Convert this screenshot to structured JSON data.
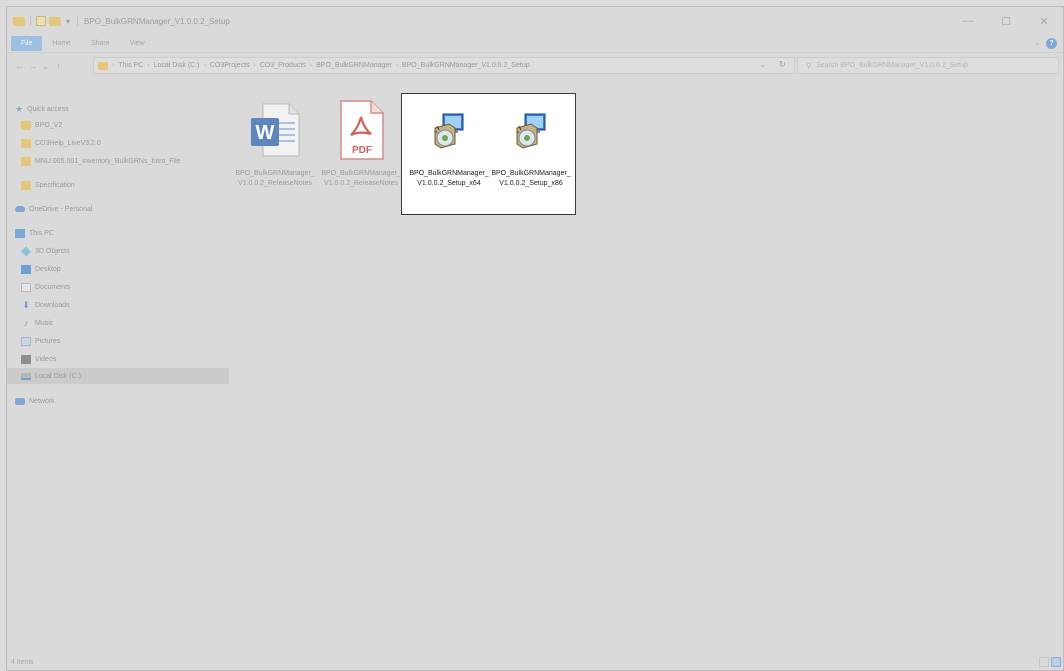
{
  "window": {
    "title": "BPO_BulkGRNManager_V1.0.0.2_Setup",
    "controls": {
      "minimize": "—",
      "maximize": "☐",
      "close": "✕"
    }
  },
  "ribbon": {
    "tabs": [
      "File",
      "Home",
      "Share",
      "View"
    ]
  },
  "address": {
    "crumbs": [
      "This PC",
      "Local Disk (C:)",
      "CO3Projects",
      "CO3_Products",
      "BPO_BulkGRNManager",
      "BPO_BulkGRNManager_V1.0.0.2_Setup"
    ],
    "search_placeholder": "Search BPO_BulkGRNManager_V1.0.0.2_Setup"
  },
  "nav": {
    "quick_access": "Quick access",
    "pinned": [
      "BPO_V2",
      "CO3Help_LiveV3.2.0",
      "MNU.005.001_Inventory_BulkGRNs_Intro_File",
      "Specification"
    ],
    "onedrive": "OneDrive - Personal",
    "this_pc": "This PC",
    "pc_items": [
      "3D Objects",
      "Desktop",
      "Documents",
      "Downloads",
      "Music",
      "Pictures",
      "Videos",
      "Local Disk (C:)"
    ],
    "network": "Network"
  },
  "files": [
    {
      "name": "BPO_BulkGRNManager_V1.0.0.2_ReleaseNotes",
      "icon": "word-doc-icon"
    },
    {
      "name": "BPO_BulkGRNManager_V1.0.0.2_ReleaseNotes",
      "icon": "pdf-icon",
      "pdf_label": "PDF"
    },
    {
      "name": "BPO_BulkGRNManager_V1.0.0.2_Setup_x64",
      "icon": "installer-icon"
    },
    {
      "name": "BPO_BulkGRNManager_V1.0.0.2_Setup_x86",
      "icon": "installer-icon"
    }
  ],
  "status": {
    "item_count": "4 items"
  },
  "colors": {
    "accent": "#7ea9d6",
    "folder": "#e4c779",
    "pdf": "#d9534f",
    "word": "#2b579a"
  }
}
